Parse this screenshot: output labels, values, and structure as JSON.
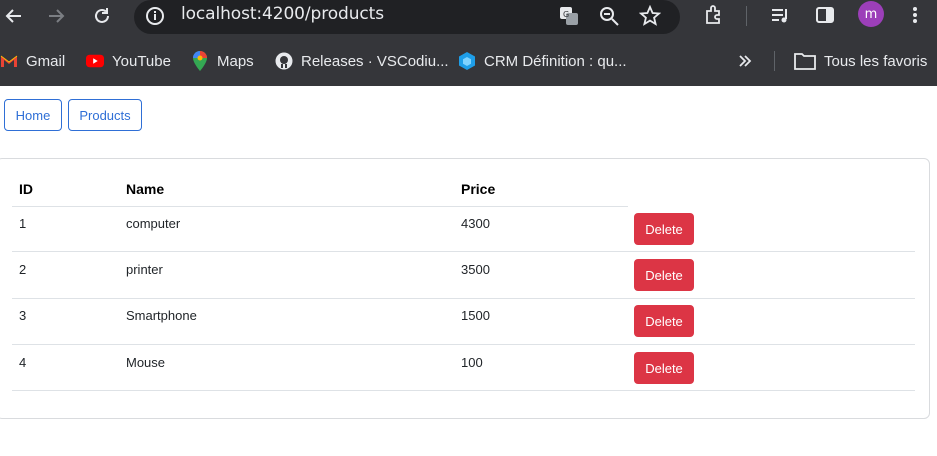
{
  "browser": {
    "url": "localhost:4200/products",
    "profile_initial": "m",
    "profile_color": "#9c3fb9"
  },
  "bookmarks": {
    "items": [
      {
        "label": "Gmail",
        "icon": "gmail-icon"
      },
      {
        "label": "YouTube",
        "icon": "youtube-icon"
      },
      {
        "label": "Maps",
        "icon": "maps-icon"
      },
      {
        "label": "Releases · VSCodiu...",
        "icon": "github-icon"
      },
      {
        "label": "CRM Définition : qu...",
        "icon": "crm-icon"
      }
    ],
    "all_bookmarks": "Tous les favoris"
  },
  "nav": {
    "home": "Home",
    "products": "Products"
  },
  "table": {
    "headers": [
      "ID",
      "Name",
      "Price"
    ],
    "rows": [
      {
        "id": "1",
        "name": "computer",
        "price": "4300",
        "action": "Delete"
      },
      {
        "id": "2",
        "name": "printer",
        "price": "3500",
        "action": "Delete"
      },
      {
        "id": "3",
        "name": "Smartphone",
        "price": "1500",
        "action": "Delete"
      },
      {
        "id": "4",
        "name": "Mouse",
        "price": "100",
        "action": "Delete"
      }
    ]
  },
  "colors": {
    "primary_outline": "#2f6fd6",
    "danger": "#dc3545",
    "chrome_dark": "#35363a"
  }
}
